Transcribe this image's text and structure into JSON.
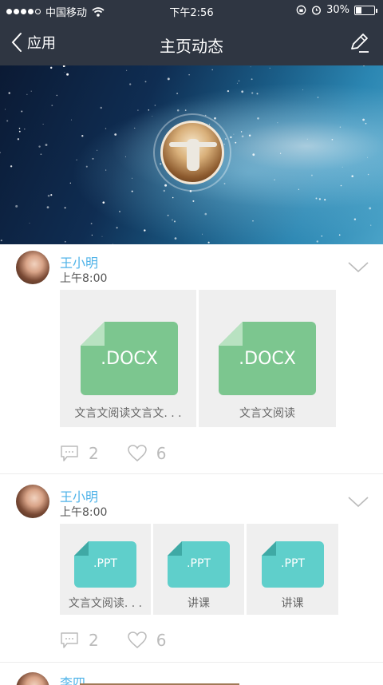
{
  "status_bar": {
    "carrier": "中国移动",
    "time": "下午2:56",
    "battery": "30%",
    "battery_level": 0.3
  },
  "nav": {
    "back_label": "应用",
    "title": "主页动态"
  },
  "posts": [
    {
      "author": "王小明",
      "time": "上午8:00",
      "files": [
        {
          "ext": ".DOCX",
          "name": "文言文阅读文言文. . ."
        },
        {
          "ext": ".DOCX",
          "name": "文言文阅读"
        }
      ],
      "comments": "2",
      "likes": "6"
    },
    {
      "author": "王小明",
      "time": "上午8:00",
      "files": [
        {
          "ext": ".PPT",
          "name": "文言文阅读. . ."
        },
        {
          "ext": ".PPT",
          "name": "讲课"
        },
        {
          "ext": ".PPT",
          "name": "讲课"
        }
      ],
      "comments": "2",
      "likes": "6"
    },
    {
      "author": "李四"
    }
  ],
  "colors": {
    "nav_bg": "#2f3642",
    "author": "#4fb3e8",
    "docx": "#7cc68f",
    "ppt": "#5fcfcb"
  },
  "icons": [
    "wifi-icon",
    "back-chevron-icon",
    "edit-icon",
    "chevron-down-icon",
    "comment-icon",
    "heart-icon",
    "lock-rotation-icon",
    "alarm-icon"
  ]
}
